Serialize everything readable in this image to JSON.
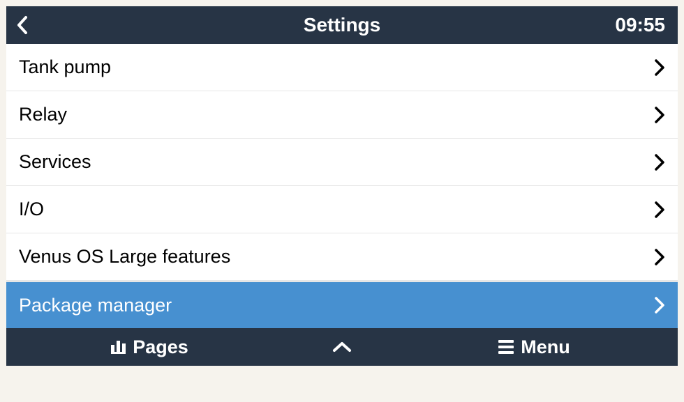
{
  "header": {
    "title": "Settings",
    "time": "09:55"
  },
  "list": {
    "items": [
      {
        "label": "Tank pump",
        "selected": false
      },
      {
        "label": "Relay",
        "selected": false
      },
      {
        "label": "Services",
        "selected": false
      },
      {
        "label": "I/O",
        "selected": false
      },
      {
        "label": "Venus OS Large features",
        "selected": false
      },
      {
        "label": "Package manager",
        "selected": true
      }
    ]
  },
  "footer": {
    "pages_label": "Pages",
    "menu_label": "Menu"
  },
  "colors": {
    "header_bg": "#273445",
    "selected_bg": "#4790d0"
  }
}
